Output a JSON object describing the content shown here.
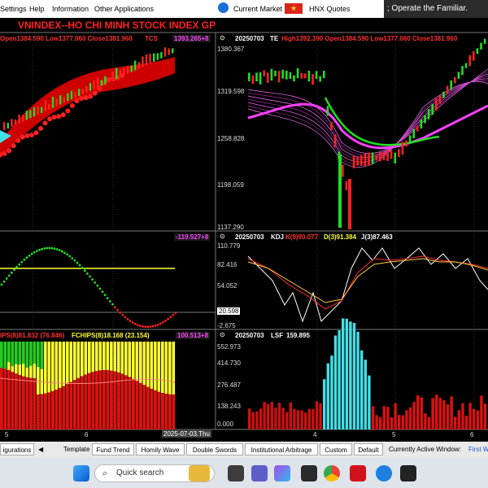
{
  "menu": {
    "items": [
      "Settings",
      "Help",
      "Information",
      "Other Applications"
    ],
    "current_market": "Current Market",
    "hnx_quotes": "HNX Quotes",
    "tooltip": "; Operate the Familiar."
  },
  "main_chart": {
    "title": "VNINDEX--HO CHI MINH STOCK INDEX  GP",
    "ohlc": "Open1384.590 Low1377.060 Close1381.960",
    "indicator": "TCS",
    "value_box": "1393.265+8"
  },
  "te_panel": {
    "date": "20250703",
    "name": "TE",
    "params": "High1392.390 Open1384.590 Low1377.060 Close1381.960",
    "y_ticks": [
      "1380.367",
      "1319.598",
      "1258.828",
      "1198.059",
      "1137.290"
    ]
  },
  "osc_panel": {
    "value_box": "-119.527+8"
  },
  "kdj_panel": {
    "date": "20250703",
    "name": "KDJ",
    "k": "K(9)90.077",
    "d": "D(3)91.384",
    "j": "J(3)87.463",
    "y_ticks": [
      "110.779",
      "82.416",
      "54.052",
      "20.598",
      "-2.675"
    ]
  },
  "chips_panel": {
    "title_a": "IPS(8)81.832 (76.846)",
    "title_b": "FCHIPS(8)18.168 (23.154)",
    "value_box": "100.513+8"
  },
  "lsf_panel": {
    "date": "20250703",
    "name": "LSF",
    "value": "159.895",
    "y_ticks": [
      "552.973",
      "414.730",
      "276.487",
      "138.243",
      "0.000"
    ]
  },
  "x_axis": {
    "left_labels": [
      "5",
      "6"
    ],
    "date_box": "2025-07-03.Thu",
    "right_labels": [
      "4",
      "5",
      "6"
    ]
  },
  "bottom_tabs": {
    "configurations": "igurations",
    "template": "Template",
    "tabs": [
      "Fund Trend",
      "Homily Wave",
      "Double Swords",
      "Institutional Arbitrage",
      "Custom",
      "Default"
    ],
    "active_label": "Currently Active Window:",
    "active_value": "First W"
  },
  "taskbar": {
    "search_placeholder": "Quick search"
  },
  "colors": {
    "up": "#ff2020",
    "down": "#22dd22",
    "accent": "#ff40ff",
    "cyan": "#40e0e8",
    "yellow": "#ffff30"
  }
}
